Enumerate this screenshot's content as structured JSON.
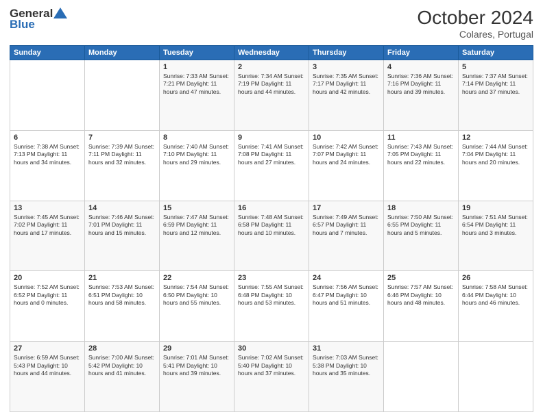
{
  "header": {
    "logo_general": "General",
    "logo_blue": "Blue",
    "month_title": "October 2024",
    "location": "Colares, Portugal"
  },
  "weekdays": [
    "Sunday",
    "Monday",
    "Tuesday",
    "Wednesday",
    "Thursday",
    "Friday",
    "Saturday"
  ],
  "weeks": [
    [
      {
        "day": "",
        "info": ""
      },
      {
        "day": "",
        "info": ""
      },
      {
        "day": "1",
        "info": "Sunrise: 7:33 AM\nSunset: 7:21 PM\nDaylight: 11 hours and 47 minutes."
      },
      {
        "day": "2",
        "info": "Sunrise: 7:34 AM\nSunset: 7:19 PM\nDaylight: 11 hours and 44 minutes."
      },
      {
        "day": "3",
        "info": "Sunrise: 7:35 AM\nSunset: 7:17 PM\nDaylight: 11 hours and 42 minutes."
      },
      {
        "day": "4",
        "info": "Sunrise: 7:36 AM\nSunset: 7:16 PM\nDaylight: 11 hours and 39 minutes."
      },
      {
        "day": "5",
        "info": "Sunrise: 7:37 AM\nSunset: 7:14 PM\nDaylight: 11 hours and 37 minutes."
      }
    ],
    [
      {
        "day": "6",
        "info": "Sunrise: 7:38 AM\nSunset: 7:13 PM\nDaylight: 11 hours and 34 minutes."
      },
      {
        "day": "7",
        "info": "Sunrise: 7:39 AM\nSunset: 7:11 PM\nDaylight: 11 hours and 32 minutes."
      },
      {
        "day": "8",
        "info": "Sunrise: 7:40 AM\nSunset: 7:10 PM\nDaylight: 11 hours and 29 minutes."
      },
      {
        "day": "9",
        "info": "Sunrise: 7:41 AM\nSunset: 7:08 PM\nDaylight: 11 hours and 27 minutes."
      },
      {
        "day": "10",
        "info": "Sunrise: 7:42 AM\nSunset: 7:07 PM\nDaylight: 11 hours and 24 minutes."
      },
      {
        "day": "11",
        "info": "Sunrise: 7:43 AM\nSunset: 7:05 PM\nDaylight: 11 hours and 22 minutes."
      },
      {
        "day": "12",
        "info": "Sunrise: 7:44 AM\nSunset: 7:04 PM\nDaylight: 11 hours and 20 minutes."
      }
    ],
    [
      {
        "day": "13",
        "info": "Sunrise: 7:45 AM\nSunset: 7:02 PM\nDaylight: 11 hours and 17 minutes."
      },
      {
        "day": "14",
        "info": "Sunrise: 7:46 AM\nSunset: 7:01 PM\nDaylight: 11 hours and 15 minutes."
      },
      {
        "day": "15",
        "info": "Sunrise: 7:47 AM\nSunset: 6:59 PM\nDaylight: 11 hours and 12 minutes."
      },
      {
        "day": "16",
        "info": "Sunrise: 7:48 AM\nSunset: 6:58 PM\nDaylight: 11 hours and 10 minutes."
      },
      {
        "day": "17",
        "info": "Sunrise: 7:49 AM\nSunset: 6:57 PM\nDaylight: 11 hours and 7 minutes."
      },
      {
        "day": "18",
        "info": "Sunrise: 7:50 AM\nSunset: 6:55 PM\nDaylight: 11 hours and 5 minutes."
      },
      {
        "day": "19",
        "info": "Sunrise: 7:51 AM\nSunset: 6:54 PM\nDaylight: 11 hours and 3 minutes."
      }
    ],
    [
      {
        "day": "20",
        "info": "Sunrise: 7:52 AM\nSunset: 6:52 PM\nDaylight: 11 hours and 0 minutes."
      },
      {
        "day": "21",
        "info": "Sunrise: 7:53 AM\nSunset: 6:51 PM\nDaylight: 10 hours and 58 minutes."
      },
      {
        "day": "22",
        "info": "Sunrise: 7:54 AM\nSunset: 6:50 PM\nDaylight: 10 hours and 55 minutes."
      },
      {
        "day": "23",
        "info": "Sunrise: 7:55 AM\nSunset: 6:48 PM\nDaylight: 10 hours and 53 minutes."
      },
      {
        "day": "24",
        "info": "Sunrise: 7:56 AM\nSunset: 6:47 PM\nDaylight: 10 hours and 51 minutes."
      },
      {
        "day": "25",
        "info": "Sunrise: 7:57 AM\nSunset: 6:46 PM\nDaylight: 10 hours and 48 minutes."
      },
      {
        "day": "26",
        "info": "Sunrise: 7:58 AM\nSunset: 6:44 PM\nDaylight: 10 hours and 46 minutes."
      }
    ],
    [
      {
        "day": "27",
        "info": "Sunrise: 6:59 AM\nSunset: 5:43 PM\nDaylight: 10 hours and 44 minutes."
      },
      {
        "day": "28",
        "info": "Sunrise: 7:00 AM\nSunset: 5:42 PM\nDaylight: 10 hours and 41 minutes."
      },
      {
        "day": "29",
        "info": "Sunrise: 7:01 AM\nSunset: 5:41 PM\nDaylight: 10 hours and 39 minutes."
      },
      {
        "day": "30",
        "info": "Sunrise: 7:02 AM\nSunset: 5:40 PM\nDaylight: 10 hours and 37 minutes."
      },
      {
        "day": "31",
        "info": "Sunrise: 7:03 AM\nSunset: 5:38 PM\nDaylight: 10 hours and 35 minutes."
      },
      {
        "day": "",
        "info": ""
      },
      {
        "day": "",
        "info": ""
      }
    ]
  ]
}
